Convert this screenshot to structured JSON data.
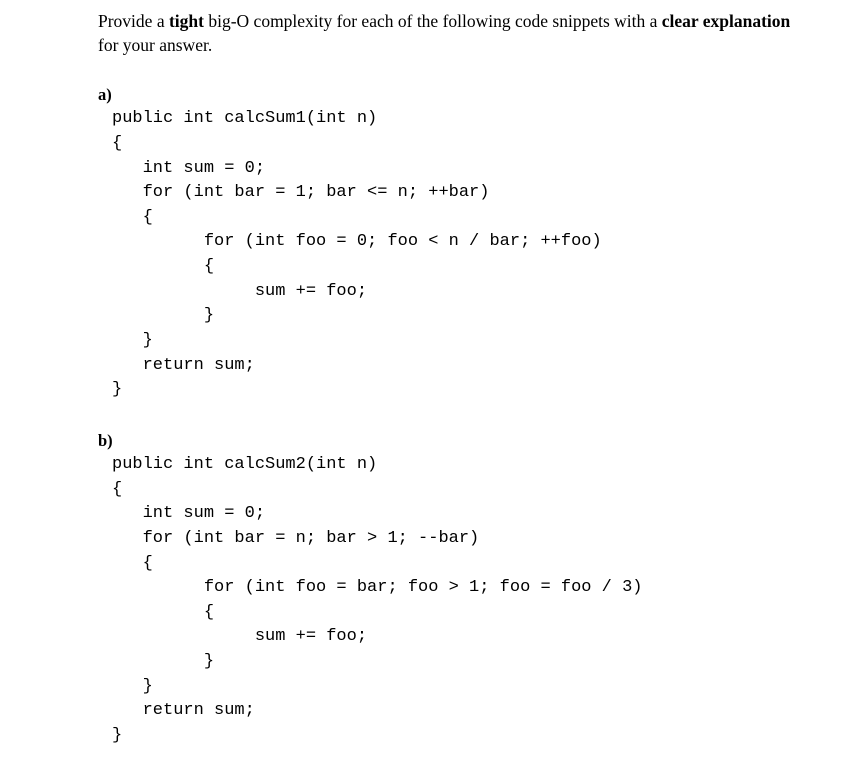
{
  "intro": {
    "pre1": "Provide a ",
    "tight": "tight",
    "mid1": " big-O complexity for each of the following code snippets with a ",
    "clear": "clear explanation",
    "post1": " for your answer."
  },
  "problems": {
    "a": {
      "label": "a)",
      "code": "public int calcSum1(int n)\n{\n   int sum = 0;\n   for (int bar = 1; bar <= n; ++bar)\n   {\n         for (int foo = 0; foo < n / bar; ++foo)\n         {\n              sum += foo;\n         }\n   }\n   return sum;\n}"
    },
    "b": {
      "label": "b)",
      "code": "public int calcSum2(int n)\n{\n   int sum = 0;\n   for (int bar = n; bar > 1; --bar)\n   {\n         for (int foo = bar; foo > 1; foo = foo / 3)\n         {\n              sum += foo;\n         }\n   }\n   return sum;\n}"
    }
  }
}
